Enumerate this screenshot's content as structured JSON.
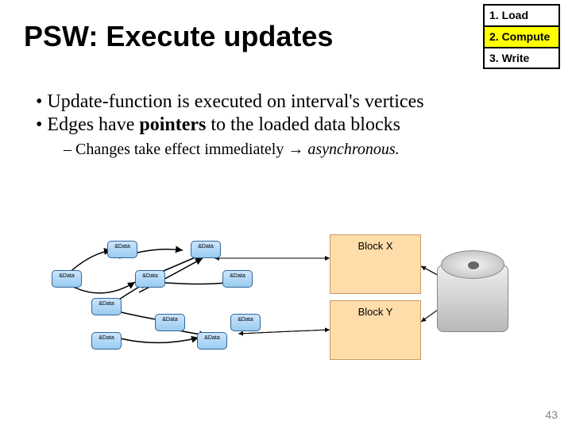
{
  "title": "PSW: Execute updates",
  "steps": [
    {
      "label": "1. Load"
    },
    {
      "label": "2. Compute"
    },
    {
      "label": "3. Write"
    }
  ],
  "bullets": {
    "b1": "Update-function is executed on interval's vertices",
    "b2_pre": "Edges have ",
    "b2_bold": "pointers",
    "b2_post": " to the loaded data blocks",
    "b3_pre": "Changes take effect immediately ",
    "b3_arrow": "→",
    "b3_ital": " asynchronous."
  },
  "node_text": "&Data",
  "blocks": {
    "x": "Block X",
    "y": "Block Y"
  },
  "page": "43"
}
